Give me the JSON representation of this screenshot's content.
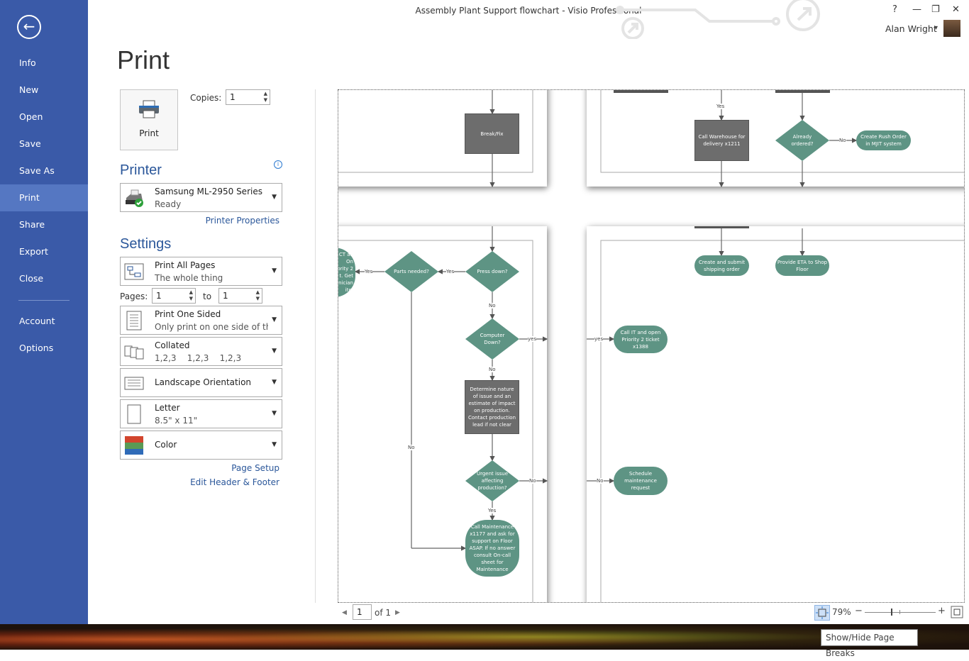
{
  "window": {
    "title": "Assembly Plant Support flowchart - Visio Professional",
    "help": "?",
    "minimize": "—",
    "restore": "❐",
    "close": "✕",
    "user": "Alan Wright",
    "user_caret": "▾"
  },
  "sidebar": {
    "back": "←",
    "items": [
      {
        "label": "Info"
      },
      {
        "label": "New"
      },
      {
        "label": "Open"
      },
      {
        "label": "Save"
      },
      {
        "label": "Save As"
      },
      {
        "label": "Print",
        "selected": true
      },
      {
        "label": "Share"
      },
      {
        "label": "Export"
      },
      {
        "label": "Close"
      },
      {
        "label": "Account"
      },
      {
        "label": "Options"
      }
    ]
  },
  "print": {
    "title": "Print",
    "button": "Print",
    "copies_label": "Copies:",
    "copies": "1"
  },
  "printer": {
    "heading": "Printer",
    "info": "i",
    "name": "Samsung ML-2950 Series",
    "status": "Ready",
    "properties": "Printer Properties"
  },
  "settings": {
    "heading": "Settings",
    "range": {
      "title": "Print All Pages",
      "sub": "The whole thing"
    },
    "pages_label": "Pages:",
    "pages_from": "1",
    "to_label": "to",
    "pages_to": "1",
    "sides": {
      "title": "Print One Sided",
      "sub": "Only print on one side of th..."
    },
    "collate": {
      "title": "Collated",
      "sub": "1,2,3    1,2,3    1,2,3"
    },
    "orientation": {
      "title": "Landscape Orientation"
    },
    "paper": {
      "title": "Letter",
      "sub": "8.5\" x 11\""
    },
    "color": {
      "title": "Color"
    },
    "page_setup": "Page Setup",
    "header_footer": "Edit Header & Footer"
  },
  "preview": {
    "shapes": {
      "break_fix": "Break/Fix",
      "call_warehouse": "Call Warehouse for\ndelivery x1211",
      "already_ordered": "Already\nordered?",
      "rush_order": "Create Rush Order\nin MJIT system",
      "shipping": "Create and submit\nshipping order",
      "eta": "Provide ETA to Shop\nFloor",
      "cropped": "CT an\nOn\nority 2\nt. Get\nnician\nite.",
      "parts_needed": "Parts needed?",
      "press_down": "Press down?",
      "computer_down": "Computer\nDown?",
      "determine": "Determine nature\nof issue and an\nestimate of impact\non production.\nContact production\nlead if not clear",
      "urgent": "Urgent issue\naffecting\nproduction?",
      "call_maintenance": "Call Maintenance\nx1177 and ask for\nsupport on Floor\nASAP. If no answer\nconsult On-call\nsheet for\nMaintenance",
      "call_it": "Call IT and open\nPriority 2 ticket\nx1388",
      "schedule": "Schedule\nmaintenance\nrequest"
    },
    "labels": {
      "yes_top": "Yes",
      "no_rush": "No",
      "yes_parts": "Yes",
      "yes_press": "Yes",
      "no_press": "No",
      "yes_comp": "yes",
      "yes_comp2": "yes",
      "no_comp": "No",
      "no_urgent": "No",
      "no_urgent2": "No",
      "yes_urgent": "Yes",
      "no_parts": "No"
    },
    "colors": {
      "process": "#6d6d6d",
      "decision": "#5e9484"
    }
  },
  "nav": {
    "page": "1",
    "of": "of 1",
    "prev": "◀",
    "next": "▶"
  },
  "zoom": {
    "level": "79%",
    "value_percent": 79,
    "minus": "−",
    "plus": "+"
  },
  "tooltip": "Show/Hide Page Breaks"
}
